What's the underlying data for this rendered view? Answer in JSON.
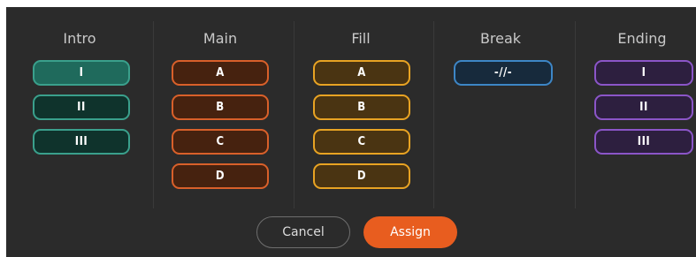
{
  "sections": {
    "intro": {
      "title": "Intro",
      "pads": [
        "I",
        "II",
        "III"
      ]
    },
    "main": {
      "title": "Main",
      "pads": [
        "A",
        "B",
        "C",
        "D"
      ]
    },
    "fill": {
      "title": "Fill",
      "pads": [
        "A",
        "B",
        "C",
        "D"
      ]
    },
    "break": {
      "title": "Break",
      "pads": [
        "-//-"
      ]
    },
    "ending": {
      "title": "Ending",
      "pads": [
        "I",
        "II",
        "III"
      ]
    }
  },
  "colors": {
    "panel_bg": "#2b2b2b",
    "intro_border": "#3aa08c",
    "intro_fill": "#0f332c",
    "intro_selected_fill": "#1f6a5c",
    "main_border": "#d9602a",
    "main_fill": "#46220f",
    "fill_border": "#e8a323",
    "fill_fill": "#4a3412",
    "break_border": "#3d86c6",
    "break_fill": "#172a3c",
    "ending_border": "#8b55c8",
    "ending_fill": "#2d1f3f",
    "assign_button": "#e85d1f"
  },
  "buttons": {
    "cancel": "Cancel",
    "assign": "Assign"
  }
}
